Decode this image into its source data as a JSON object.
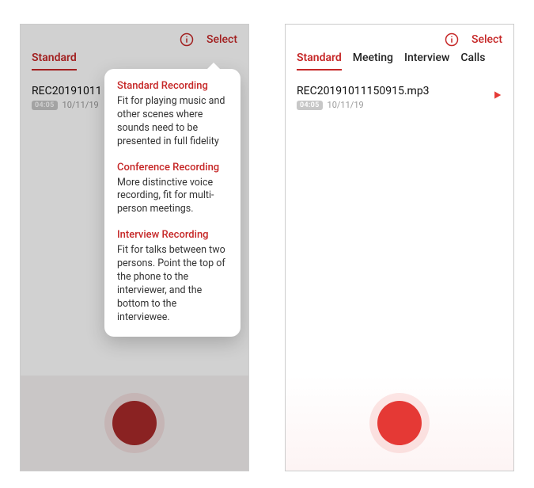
{
  "topbar": {
    "select_label": "Select"
  },
  "left": {
    "tabs": [
      {
        "label": "Standard",
        "active": true
      }
    ],
    "recording": {
      "name": "REC20191011",
      "duration": "04:05",
      "date": "10/11/19"
    },
    "popover": {
      "sections": [
        {
          "title": "Standard Recording",
          "body": "Fit for playing music and other scenes where sounds need to be presented in full fidelity"
        },
        {
          "title": "Conference Recording",
          "body": "More distinctive voice recording, fit for multi-person meetings."
        },
        {
          "title": "Interview Recording",
          "body": "Fit for talks between two persons. Point the top of the phone to the interviewer, and the bottom to the interviewee."
        }
      ]
    }
  },
  "right": {
    "tabs": [
      {
        "label": "Standard",
        "active": true
      },
      {
        "label": "Meeting",
        "active": false
      },
      {
        "label": "Interview",
        "active": false
      },
      {
        "label": "Calls",
        "active": false
      }
    ],
    "recording": {
      "name": "REC20191011150915.mp3",
      "duration": "04:05",
      "date": "10/11/19"
    }
  },
  "colors": {
    "accent": "#c62828"
  }
}
